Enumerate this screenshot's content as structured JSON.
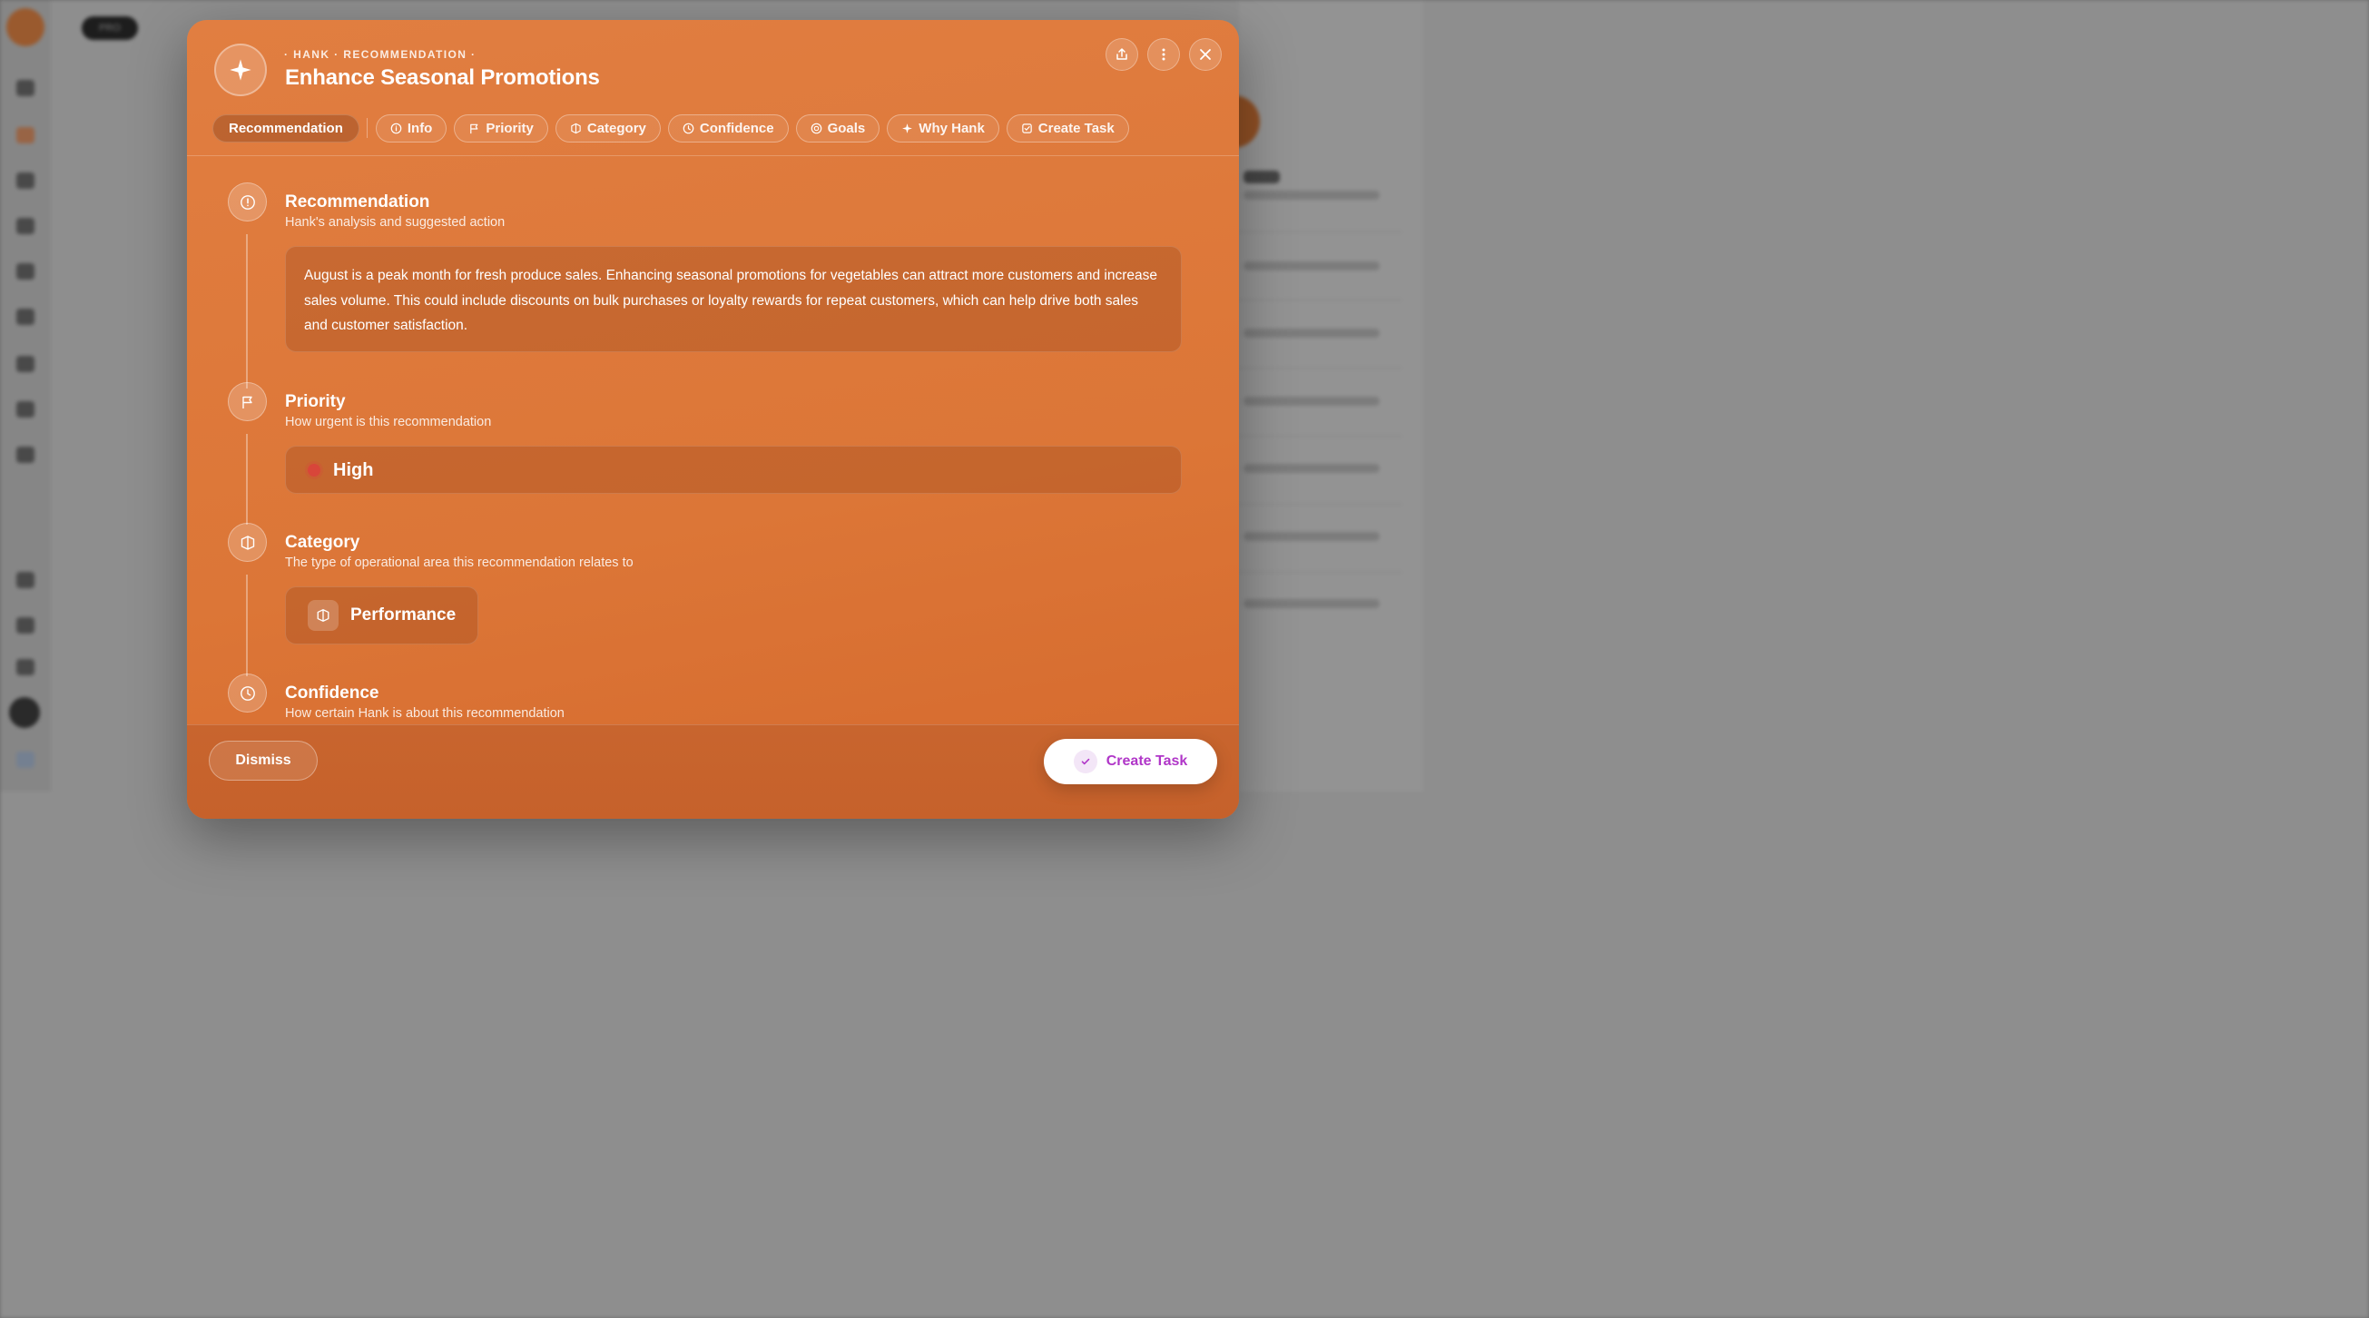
{
  "background": {
    "pill_label": "PRO"
  },
  "modal": {
    "eyebrow": "· HANK · RECOMMENDATION ·",
    "title": "Enhance Seasonal Promotions",
    "tabs": [
      {
        "label": "Recommendation",
        "icon": "none",
        "active": true
      },
      {
        "label": "Info",
        "icon": "info-icon"
      },
      {
        "label": "Priority",
        "icon": "flag-icon"
      },
      {
        "label": "Category",
        "icon": "cube-icon"
      },
      {
        "label": "Confidence",
        "icon": "clock-icon"
      },
      {
        "label": "Goals",
        "icon": "target-icon"
      },
      {
        "label": "Why Hank",
        "icon": "sparkle-icon"
      },
      {
        "label": "Create Task",
        "icon": "checkbox-icon"
      }
    ],
    "sections": {
      "recommendation": {
        "title": "Recommendation",
        "subtitle": "Hank's analysis and suggested action",
        "body": "August is a peak month for fresh produce sales. Enhancing seasonal promotions for vegetables can attract more customers and increase sales volume. This could include discounts on bulk purchases or loyalty rewards for repeat customers, which can help drive both sales and customer satisfaction."
      },
      "priority": {
        "title": "Priority",
        "subtitle": "How urgent is this recommendation",
        "value": "High",
        "color": "#d8463a"
      },
      "category": {
        "title": "Category",
        "subtitle": "The type of operational area this recommendation relates to",
        "value": "Performance"
      },
      "confidence": {
        "title": "Confidence",
        "subtitle": "How certain Hank is about this recommendation"
      }
    },
    "footer": {
      "dismiss_label": "Dismiss",
      "create_label": "Create Task"
    }
  },
  "colors": {
    "modal_accent": "#dc7637",
    "create_text": "#b036c8"
  }
}
